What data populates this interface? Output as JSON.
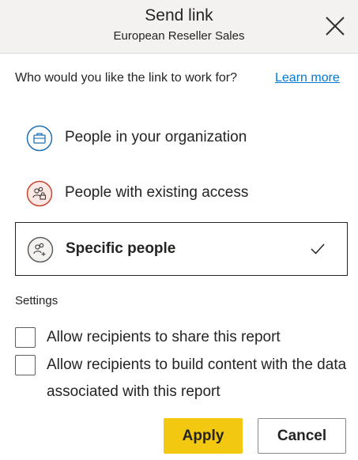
{
  "dialog": {
    "title": "Send link",
    "subtitle": "European Reseller Sales",
    "close_icon": "close-icon"
  },
  "prompt": {
    "text": "Who would you like the link to work for?",
    "learn_more": "Learn more"
  },
  "options": [
    {
      "label": "People in your organization",
      "icon": "briefcase-icon",
      "icon_color": "#1f6fb5",
      "selected": false
    },
    {
      "label": "People with existing access",
      "icon": "people-lock-icon",
      "icon_color": "#c8452f",
      "selected": false
    },
    {
      "label": "Specific people",
      "icon": "people-add-icon",
      "icon_color": "#605e5c",
      "selected": true
    }
  ],
  "settings": {
    "heading": "Settings",
    "checkboxes": [
      {
        "label": "Allow recipients to share this report",
        "checked": false
      },
      {
        "label": "Allow recipients to build content with the data associated with this report",
        "checked": false
      }
    ]
  },
  "footer": {
    "apply": "Apply",
    "cancel": "Cancel"
  },
  "colors": {
    "accent": "#f2c811",
    "link": "#0078d4",
    "header_bg": "#f3f2f1"
  }
}
